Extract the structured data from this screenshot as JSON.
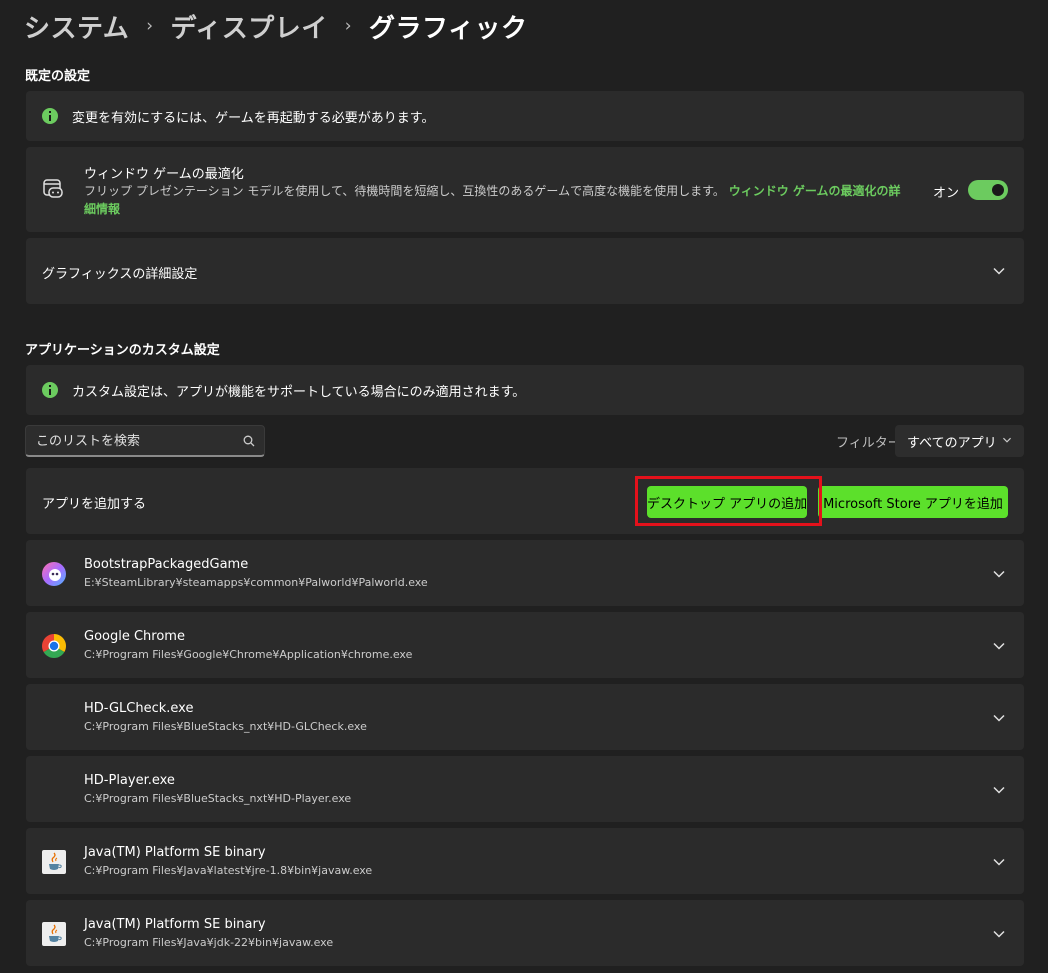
{
  "breadcrumb": {
    "items": [
      "システム",
      "ディスプレイ",
      "グラフィック"
    ],
    "separator": "›"
  },
  "default_section": {
    "title": "既定の設定",
    "notice": "変更を有効にするには、ゲームを再起動する必要があります。",
    "window_opt": {
      "title": "ウィンドウ ゲームの最適化",
      "description": "フリップ プレゼンテーション モデルを使用して、待機時間を短縮し、互換性のあるゲームで高度な機能を使用します。",
      "link": "ウィンドウ ゲームの最適化の詳細情報",
      "toggle_label": "オン",
      "toggle_on": true
    },
    "advanced": "グラフィックスの詳細設定"
  },
  "app_section": {
    "title": "アプリケーションのカスタム設定",
    "notice": "カスタム設定は、アプリが機能をサポートしている場合にのみ適用されます。",
    "search_placeholder": "このリストを検索",
    "filter_label": "フィルター:",
    "filter_value": "すべてのアプリ",
    "add_label": "アプリを追加する",
    "add_desktop": "デスクトップ アプリの追加",
    "add_store": "Microsoft Store アプリを追加"
  },
  "apps": [
    {
      "name": "BootstrapPackagedGame",
      "path": "E:¥SteamLibrary¥steamapps¥common¥Palworld¥Palworld.exe",
      "icon": "palworld-icon"
    },
    {
      "name": "Google Chrome",
      "path": "C:¥Program Files¥Google¥Chrome¥Application¥chrome.exe",
      "icon": "chrome-icon"
    },
    {
      "name": "HD-GLCheck.exe",
      "path": "C:¥Program Files¥BlueStacks_nxt¥HD-GLCheck.exe",
      "icon": ""
    },
    {
      "name": "HD-Player.exe",
      "path": "C:¥Program Files¥BlueStacks_nxt¥HD-Player.exe",
      "icon": ""
    },
    {
      "name": "Java(TM) Platform SE binary",
      "path": "C:¥Program Files¥Java¥latest¥jre-1.8¥bin¥javaw.exe",
      "icon": "java-icon"
    },
    {
      "name": "Java(TM) Platform SE binary",
      "path": "C:¥Program Files¥Java¥jdk-22¥bin¥javaw.exe",
      "icon": "java-icon"
    }
  ],
  "colors": {
    "accent": "#6ccb5f",
    "button_green": "#5ce02b",
    "highlight": "#e4111b",
    "background": "#202020",
    "card": "#2b2b2b"
  }
}
